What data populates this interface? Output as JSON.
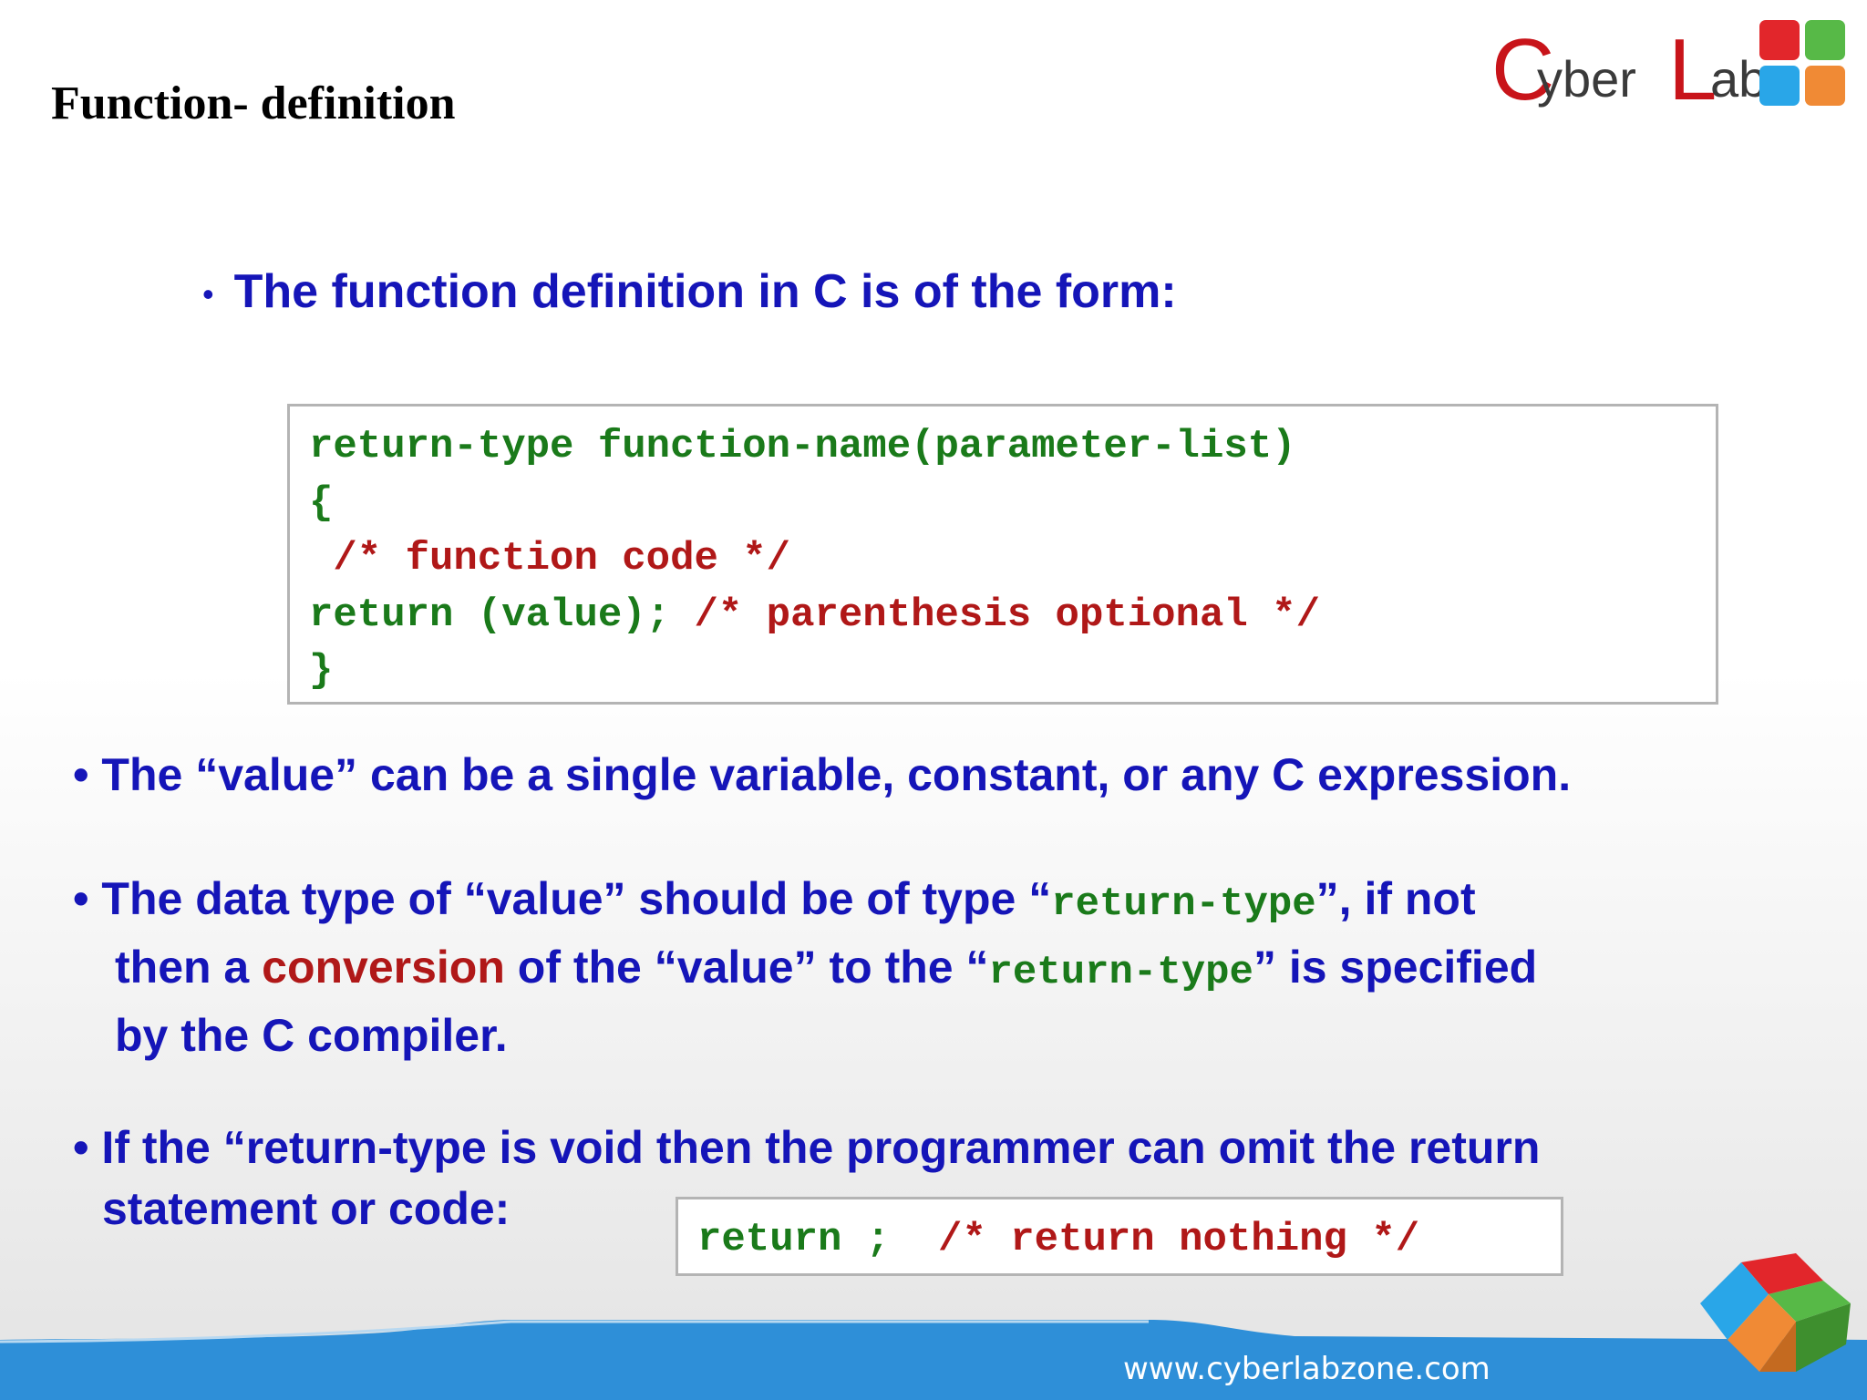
{
  "slide": {
    "title": "Function- definition",
    "bullet_char": "•"
  },
  "logo": {
    "letters": [
      "C",
      "yber",
      "L",
      "ab"
    ],
    "alt": "CyberLab",
    "colors": {
      "red": "#e2262b",
      "green": "#57b947",
      "blue": "#29a6e8",
      "orange": "#f08a35"
    }
  },
  "intro": {
    "text": "The function definition in C is of the form:"
  },
  "code_block": {
    "lines": [
      [
        {
          "text": "return-type function-name(parameter-list)",
          "color": "green"
        }
      ],
      [
        {
          "text": "{",
          "color": "green"
        }
      ],
      [
        {
          "text": " /* function code */",
          "color": "red"
        }
      ],
      [
        {
          "text": "return (value); ",
          "color": "green"
        },
        {
          "text": "/* parenthesis optional */",
          "color": "red"
        }
      ],
      [
        {
          "text": "}",
          "color": "green"
        }
      ]
    ]
  },
  "bullets": {
    "b1": {
      "text": "The “value” can be a single variable, constant, or any C expression."
    },
    "b2": {
      "part1": "The data type of  “value” should be of type “",
      "code1": "return-type",
      "part2": "”, if not",
      "part3": "then a ",
      "highlight": "conversion",
      "part4": "  of the “value” to the “",
      "code2": "return-type",
      "part5": "” is specified",
      "part6": "by the C compiler."
    },
    "b3": {
      "line1": "If the “return-type is void then the programmer can omit the return",
      "line2": "statement or code:"
    }
  },
  "small_code": {
    "green": "return ;  ",
    "red": "/* return nothing */"
  },
  "footer": {
    "url": "www.cyberlabzone.com"
  },
  "colors": {
    "bullet_text": "#1515b8",
    "code_green": "#1a7a1a",
    "code_red": "#b01818",
    "footer_band": "#2e8fd8"
  }
}
